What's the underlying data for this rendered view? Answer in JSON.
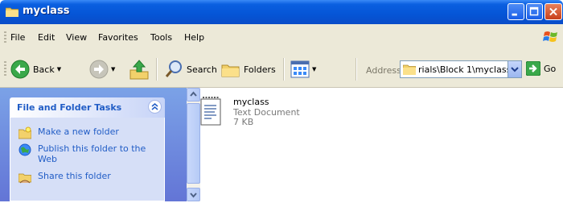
{
  "window": {
    "title": "myclass",
    "accent_color": "#0555d6",
    "close_color": "#c8401c"
  },
  "menu": [
    "File",
    "Edit",
    "View",
    "Favorites",
    "Tools",
    "Help"
  ],
  "toolbar": {
    "back_label": "Back",
    "search_label": "Search",
    "folders_label": "Folders"
  },
  "address": {
    "label": "Address",
    "value": "rials\\Block 1\\myclass",
    "go_label": "Go"
  },
  "task_pane": {
    "title": "File and Folder Tasks",
    "links": [
      {
        "label": "Make a new folder",
        "icon": "new-folder-icon"
      },
      {
        "label": "Publish this folder to the Web",
        "icon": "publish-web-icon"
      },
      {
        "label": "Share this folder",
        "icon": "share-folder-icon"
      }
    ]
  },
  "files": [
    {
      "name": "myclass",
      "type": "Text Document",
      "size": "7 KB",
      "icon": "text-document-icon"
    }
  ]
}
